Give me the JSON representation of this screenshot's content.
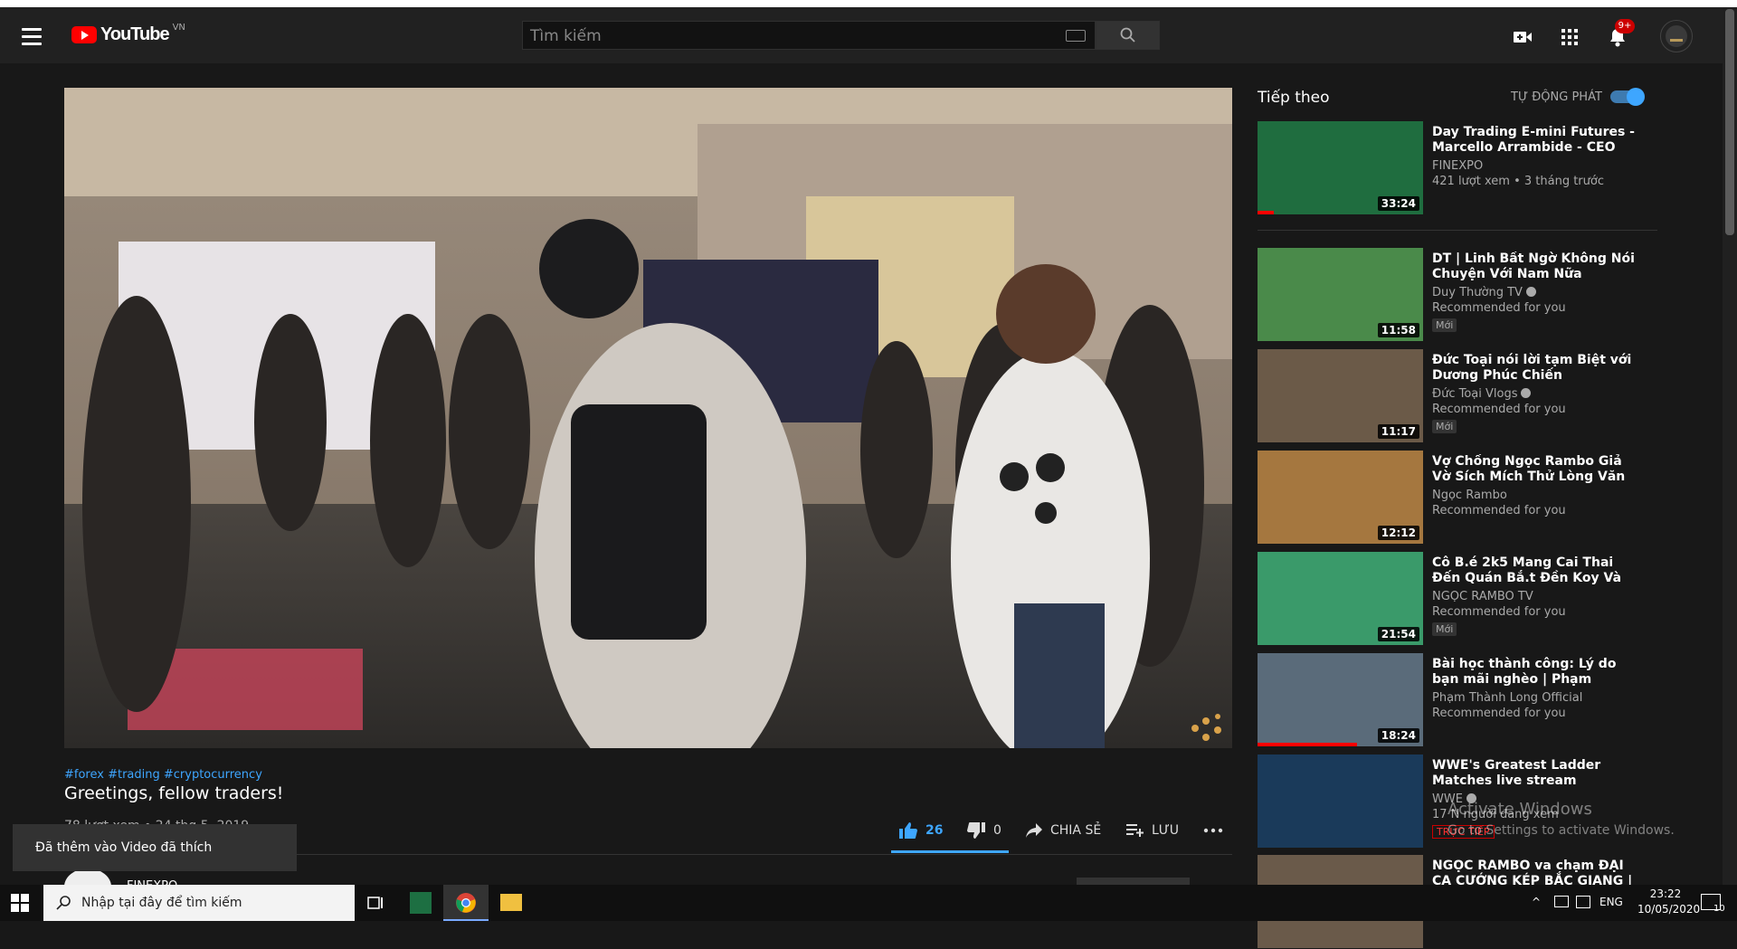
{
  "header": {
    "logo_text": "YouTube",
    "country_code": "VN",
    "search_placeholder": "Tìm kiếm",
    "notification_count": "9+"
  },
  "video": {
    "hashtags": "#forex #trading #cryptocurrency",
    "title": "Greetings, fellow traders!",
    "views_date": "78 lượt xem • 24 thg 5, 2019",
    "likes": "26",
    "dislikes": "0",
    "share_label": "CHIA SẺ",
    "save_label": "LƯU",
    "channel": "FINEXPO"
  },
  "toast": "Đã thêm vào Video đã thích",
  "sidebar": {
    "up_next_label": "Tiếp theo",
    "autoplay_label": "TỰ ĐỘNG PHÁT",
    "items": [
      {
        "title": "Day Trading E-mini Futures - Marcello Arrambide - CEO and...",
        "channel": "FINEXPO",
        "meta": "421 lượt xem • 3 tháng trước",
        "duration": "33:24",
        "badge": "",
        "verified": false,
        "progress": 0.1,
        "thumb_color": "#1f6d3f"
      },
      {
        "title": "DT | Linh Bất Ngờ Không Nói Chuyện Với Nam Nữa",
        "channel": "Duy Thường TV",
        "meta": "Recommended for you",
        "duration": "11:58",
        "badge": "Mới",
        "verified": true,
        "progress": 0,
        "thumb_color": "#4a8a4a"
      },
      {
        "title": "Đức Toại nói lời tạm Biệt với Dương Phúc Chiến",
        "channel": "Đức Toại Vlogs",
        "meta": "Recommended for you",
        "duration": "11:17",
        "badge": "Mới",
        "verified": true,
        "progress": 0,
        "thumb_color": "#6b5a48"
      },
      {
        "title": "Vợ Chồng Ngọc Rambo Giả Vờ Sích Mích Thử Lòng Văn Thật...",
        "channel": "Ngọc Rambo",
        "meta": "Recommended for you",
        "duration": "12:12",
        "badge": "",
        "verified": false,
        "progress": 0,
        "thumb_color": "#a5773f"
      },
      {
        "title": "Cô B.é 2k5 Mang Cai Thai Đến Quán Bắ.t Đền Koy Và Phả.n...",
        "channel": "NGỌC RAMBO TV",
        "meta": "Recommended for you",
        "duration": "21:54",
        "badge": "Mới",
        "verified": false,
        "progress": 0,
        "thumb_color": "#3a9a6a"
      },
      {
        "title": "Bài học thành công: Lý do bạn mãi nghèo | Phạm Thành Long",
        "channel": "Phạm Thành Long Official",
        "meta": "Recommended for you",
        "duration": "18:24",
        "badge": "",
        "verified": false,
        "progress": 0.6,
        "thumb_color": "#5a6b7a"
      },
      {
        "title": "WWE's Greatest Ladder Matches live stream",
        "channel": "WWE",
        "meta": "17 N người đang xem",
        "duration": "",
        "badge": "TRỰC TIẾP",
        "verified": true,
        "progress": 0,
        "thumb_color": "#1a3a5a"
      },
      {
        "title": "NGỌC RAMBO va chạm ĐẠI CA CƯỚNG KÉP BẮC GIANG | CA...",
        "channel": "",
        "meta": "",
        "duration": "",
        "badge": "",
        "verified": false,
        "progress": 0,
        "thumb_color": "#6a5a4a"
      }
    ]
  },
  "watermark": {
    "line1": "Activate Windows",
    "line2": "Go to Settings to activate Windows."
  },
  "taskbar": {
    "search_placeholder": "Nhập tại đây để tìm kiếm",
    "language": "ENG",
    "time": "23:22",
    "date": "10/05/2020",
    "notif_count": "10"
  },
  "colors": {
    "accent": "#3ea6ff",
    "brand_red": "#ff0000"
  }
}
